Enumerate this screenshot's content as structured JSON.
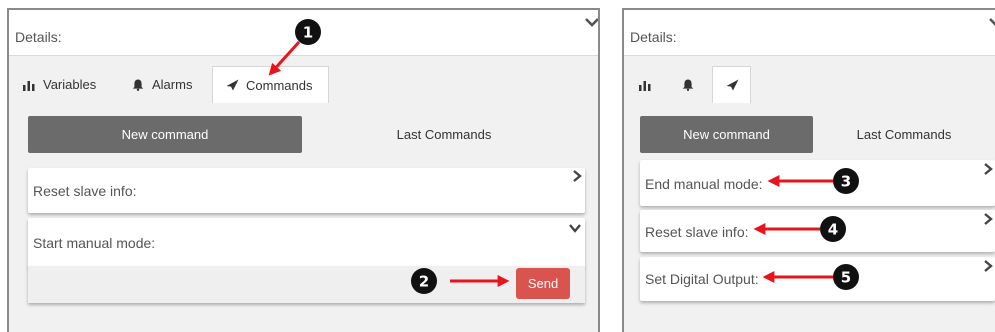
{
  "left_panel": {
    "details_label": "Details:",
    "tabs": [
      {
        "label": "Variables",
        "icon": "bar-chart-icon"
      },
      {
        "label": "Alarms",
        "icon": "bell-icon"
      },
      {
        "label": "Commands",
        "icon": "paper-plane-icon",
        "active": true
      }
    ],
    "segments": {
      "new_command": "New command",
      "last_commands": "Last Commands"
    },
    "commands": [
      {
        "label": "Reset slave info:",
        "expanded": false
      },
      {
        "label": "Start manual mode:",
        "expanded": true
      }
    ],
    "send_label": "Send"
  },
  "right_panel": {
    "details_label": "Details:",
    "tabs": [
      {
        "icon": "bar-chart-icon"
      },
      {
        "icon": "bell-icon"
      },
      {
        "icon": "paper-plane-icon",
        "active": true
      }
    ],
    "segments": {
      "new_command": "New command",
      "last_commands": "Last Commands"
    },
    "commands": [
      {
        "label": "End manual mode:"
      },
      {
        "label": "Reset slave info:"
      },
      {
        "label": "Set Digital Output:"
      }
    ]
  },
  "callouts": [
    "1",
    "2",
    "3",
    "4",
    "5"
  ],
  "colors": {
    "accent_send": "#d9534f",
    "active_segment": "#6b6b6b",
    "arrow": "#e8141b",
    "callout": "#111111"
  }
}
